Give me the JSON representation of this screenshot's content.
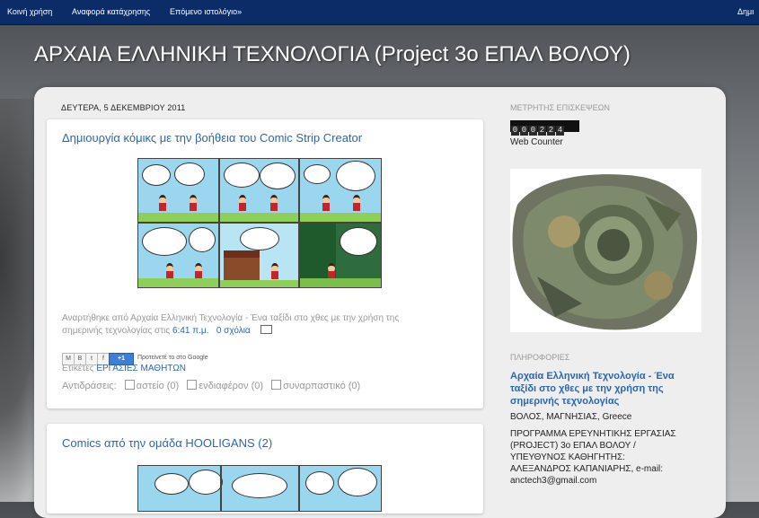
{
  "navbar": {
    "link1": "Κοινή χρήση",
    "link2": "Αναφορά κατάχρησης",
    "link3": "Επόμενο ιστολόγιο»",
    "link4": "Δημι"
  },
  "blog": {
    "title": "ΑΡΧΑΙΑ ΕΛΛΗΝΙΚΗ ΤΕΧΝΟΛΟΓΙΑ (Project 3o ΕΠΑΛ ΒΟΛΟΥ)",
    "date_header": "ΔΕΥΤΕΡΑ, 5 ΔΕΚΕΜΒΡΙΟΥ 2011"
  },
  "post1": {
    "title": "Δημιουργία κόμικς με την βοήθεια του Comic Strip Creator",
    "posted_by_prefix": "Αναρτήθηκε από Αρχαία Ελληνική Τεχνολογία - Ένα ταξίδι στο χθες με την χρήση της",
    "posted_line2_prefix": "σημερινής τεχνολογίας στις",
    "time": "6:41 π.μ.",
    "comments": "0 σχόλια",
    "share": {
      "m": "M",
      "b": "B",
      "t": "t",
      "f": "f",
      "plus": "+1",
      "recommend": "Προτείνετέ το στο Google"
    },
    "labels_prefix": "Ετικέτες",
    "label": "ΕΡΓΑΣΙΕΣ ΜΑΘΗΤΩΝ",
    "reactions_prefix": "Αντιδράσεις:",
    "reactions": [
      "αστείο (0)",
      "ενδιαφέρον (0)",
      "συναρπαστικό (0)"
    ]
  },
  "post2": {
    "title": "Comics από την ομάδα HOOLIGANS (2)"
  },
  "sidebar": {
    "counter_heading": "ΜΕΤΡΗΤΗΣ ΕΠΙΣΚΕΨΕΩΝ",
    "counter_digits": [
      "0",
      "0",
      "0",
      "2",
      "2",
      "4"
    ],
    "counter_label": "Web Counter",
    "info_heading": "ΠΛΗΡΟΦΟΡΙΕΣ",
    "profile_name_line1": "Αρχαία Ελληνική Τεχνολογία - Ένα",
    "profile_name_line2": "ταξίδι στο χθες με την χρήση της",
    "profile_name_line3": "σημερινής τεχνολογίας",
    "location": "ΒΟΛΟΣ, ΜΑΓΝΗΣΙΑΣ, Greece",
    "about_line1": "ΠΡΟΓΡΑΜΜΑ ΕΡΕΥΝΗΤΙΚΗΣ ΕΡΓΑΣΙΑΣ",
    "about_line2": "(PROJECT) 3ο ΕΠΑΛ ΒΟΛΟΥ /",
    "about_line3": "ΥΠΕΥΘΥΝΟΣ ΚΑΘΗΓΗΤΗΣ:",
    "about_line4": "ΑΛΕΞΑΝΔΡΟΣ ΚΑΠΑΝΙΑΡΗΣ, e-mail:",
    "about_line5": "anctech3@gmail.com"
  }
}
